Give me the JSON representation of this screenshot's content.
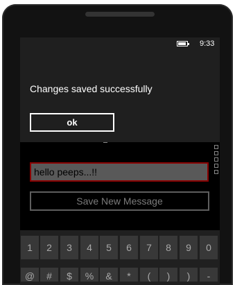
{
  "status": {
    "time": "9:33",
    "battery_icon": "battery-icon"
  },
  "dialog": {
    "message": "Changes saved successfully",
    "ok_label": "ok"
  },
  "form": {
    "message_value": "hello peeps...!!",
    "save_label": "Save New Message"
  },
  "keyboard": {
    "digits": [
      "1",
      "2",
      "3",
      "4",
      "5",
      "6",
      "7",
      "8",
      "9",
      "0"
    ],
    "symbols": [
      "@",
      "#",
      "$",
      "%",
      "&",
      "*",
      "(",
      ")",
      ")",
      "-"
    ]
  },
  "colors": {
    "dialog_bg": "#1f1f1f",
    "input_border": "#8b0000",
    "input_bg": "#595959"
  }
}
